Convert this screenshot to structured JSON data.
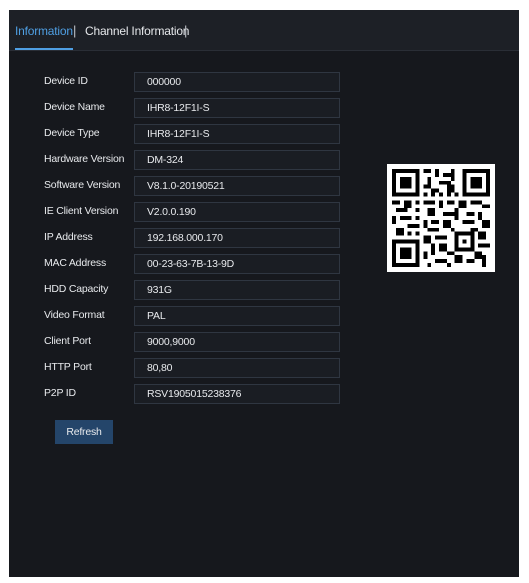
{
  "tabs": [
    {
      "label": "Information"
    },
    {
      "label": "Channel Information"
    }
  ],
  "tab_separator": "|",
  "rows": [
    {
      "label": "Device ID",
      "value": "000000"
    },
    {
      "label": "Device Name",
      "value": "IHR8-12F1I-S"
    },
    {
      "label": "Device Type",
      "value": "IHR8-12F1I-S"
    },
    {
      "label": "Hardware Version",
      "value": "DM-324"
    },
    {
      "label": "Software Version",
      "value": "V8.1.0-20190521"
    },
    {
      "label": "IE Client Version",
      "value": "V2.0.0.190"
    },
    {
      "label": "IP Address",
      "value": "192.168.000.170"
    },
    {
      "label": "MAC Address",
      "value": "00-23-63-7B-13-9D"
    },
    {
      "label": "HDD Capacity",
      "value": "931G"
    },
    {
      "label": "Video Format",
      "value": "PAL"
    },
    {
      "label": "Client Port",
      "value": "9000,9000"
    },
    {
      "label": "HTTP Port",
      "value": "80,80"
    },
    {
      "label": "P2P ID",
      "value": "RSV1905015238376"
    }
  ],
  "refresh_label": "Refresh",
  "colors": {
    "accent": "#4f9fe3",
    "panel_bg": "#16181d",
    "button_bg": "#24456a"
  },
  "icons": [
    "qr-code-icon"
  ]
}
